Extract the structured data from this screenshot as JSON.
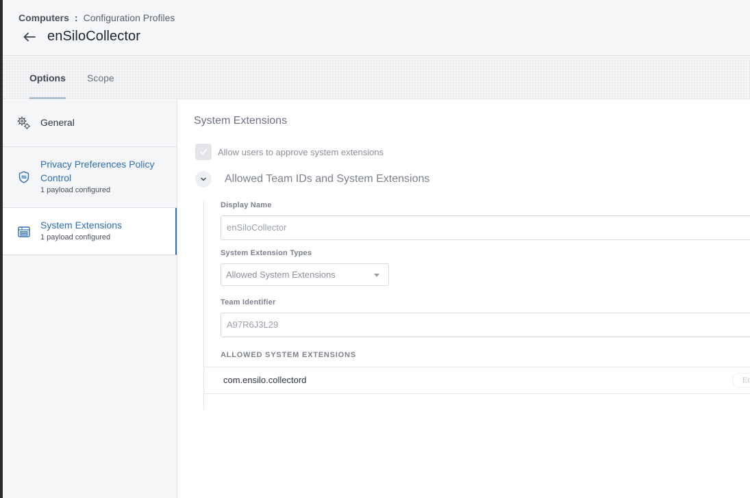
{
  "header": {
    "breadcrumb_root": "Computers",
    "breadcrumb_separator": ":",
    "breadcrumb_current": "Configuration Profiles",
    "title": "enSiloCollector"
  },
  "tabs": [
    {
      "label": "Options",
      "active": true
    },
    {
      "label": "Scope",
      "active": false
    }
  ],
  "sidebar": {
    "items": [
      {
        "label": "General",
        "sub": "",
        "icon": "gears-icon",
        "active": false
      },
      {
        "label_line1": "Privacy Preferences Policy",
        "label_line2": "Control",
        "sub": "1 payload configured",
        "icon": "shield-icon",
        "active": false
      },
      {
        "label": "System Extensions",
        "sub": "1 payload configured",
        "icon": "system-extensions-icon",
        "active": true
      }
    ]
  },
  "main": {
    "section_title": "System Extensions",
    "checkbox_label": "Allow users to approve system extensions",
    "checkbox_checked": true,
    "group_title": "Allowed Team IDs and System Extensions",
    "display_name_label": "Display Name",
    "display_name_value": "enSiloCollector",
    "types_label": "System Extension Types",
    "types_value": "Allowed System Extensions",
    "team_id_label": "Team Identifier",
    "team_id_value": "A97R6J3L29",
    "list_header": "ALLOWED SYSTEM EXTENSIONS",
    "list_items": [
      "com.ensilo.collectord"
    ],
    "edit_label": "Edit"
  },
  "colors": {
    "accent": "#2f6fb5",
    "link": "#2c6db3",
    "header_bg": "#f5f6f8"
  }
}
